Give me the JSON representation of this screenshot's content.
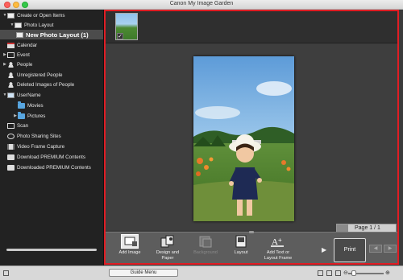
{
  "window": {
    "title": "Canon My Image Garden"
  },
  "sidebar": {
    "items": [
      {
        "label": "Create or Open Items",
        "icon": "create-items-icon"
      },
      {
        "label": "Photo Layout",
        "icon": "photo-layout-icon"
      },
      {
        "label": "New Photo Layout (1)",
        "icon": "layout-item-icon"
      },
      {
        "label": "Calendar",
        "icon": "calendar-icon"
      },
      {
        "label": "Event",
        "icon": "event-icon"
      },
      {
        "label": "People",
        "icon": "people-icon"
      },
      {
        "label": "Unregistered People",
        "icon": "unregistered-people-icon"
      },
      {
        "label": "Deleted Images of People",
        "icon": "deleted-people-icon"
      },
      {
        "label": "UserName",
        "icon": "computer-icon"
      },
      {
        "label": "Movies",
        "icon": "folder-icon"
      },
      {
        "label": "Pictures",
        "icon": "folder-icon"
      },
      {
        "label": "Scan",
        "icon": "scan-icon"
      },
      {
        "label": "Photo Sharing Sites",
        "icon": "globe-icon"
      },
      {
        "label": "Video Frame Capture",
        "icon": "film-icon"
      },
      {
        "label": "Download PREMIUM Contents",
        "icon": "download-icon"
      },
      {
        "label": "Downloaded PREMIUM Contents",
        "icon": "downloaded-icon"
      }
    ]
  },
  "main": {
    "page_indicator": "Page 1 / 1",
    "toolbar": {
      "add_image": "Add Image",
      "design_and_paper": "Design and Paper",
      "background": "Background",
      "layout": "Layout",
      "add_text": "Add Text or Layout Frame",
      "print": "Print"
    }
  },
  "bottombar": {
    "guide_menu": "Guide Menu"
  },
  "colors": {
    "highlight_frame": "#e01d24",
    "sidebar_bg": "#222222",
    "selected_item_bg": "#4c4c4c"
  }
}
